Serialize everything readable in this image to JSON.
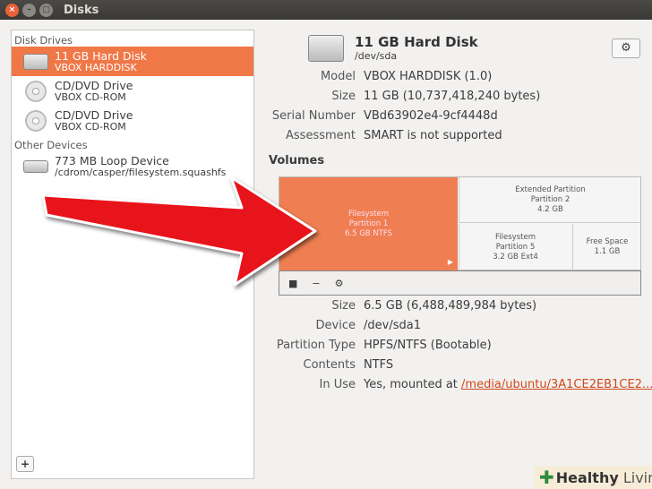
{
  "window": {
    "title": "Disks"
  },
  "sidebar": {
    "sections": [
      {
        "label": "Disk Drives",
        "items": [
          {
            "name": "11 GB Hard Disk",
            "sub": "VBOX HARDDISK",
            "icon": "hard-disk-icon"
          },
          {
            "name": "CD/DVD Drive",
            "sub": "VBOX CD-ROM",
            "icon": "cdrom-icon"
          },
          {
            "name": "CD/DVD Drive",
            "sub": "VBOX CD-ROM",
            "icon": "cdrom-icon"
          }
        ]
      },
      {
        "label": "Other Devices",
        "items": [
          {
            "name": "773 MB Loop Device",
            "sub": "/cdrom/casper/filesystem.squashfs",
            "icon": "loop-device-icon"
          }
        ]
      }
    ],
    "add_label": "+"
  },
  "disk": {
    "title": "11 GB Hard Disk",
    "device": "/dev/sda",
    "gear": "⚙",
    "props": [
      {
        "k": "Model",
        "v": "VBOX HARDDISK (1.0)"
      },
      {
        "k": "Size",
        "v": "11 GB (10,737,418,240 bytes)"
      },
      {
        "k": "Serial Number",
        "v": "VBd63902e4-9cf4448d"
      },
      {
        "k": "Assessment",
        "v": "SMART is not supported"
      }
    ]
  },
  "volumes": {
    "label": "Volumes",
    "partitions": [
      {
        "l1": "Filesystem",
        "l2": "Partition 1",
        "l3": "6.5 GB NTFS"
      },
      {
        "l1": "Extended Partition",
        "l2": "Partition 2",
        "l3": "4.2 GB"
      },
      {
        "l1": "Filesystem",
        "l2": "Partition 5",
        "l3": "3.2 GB Ext4"
      },
      {
        "l1": "Free Space",
        "l2": "1.1 GB"
      }
    ],
    "tools": {
      "stop": "■",
      "remove": "−",
      "settings": "⚙"
    }
  },
  "partition": {
    "props": [
      {
        "k": "Size",
        "v": "6.5 GB (6,488,489,984 bytes)"
      },
      {
        "k": "Device",
        "v": "/dev/sda1"
      },
      {
        "k": "Partition Type",
        "v": "HPFS/NTFS (Bootable)"
      },
      {
        "k": "Contents",
        "v": "NTFS"
      }
    ],
    "in_use": {
      "k": "In Use",
      "v": "Yes, mounted at ",
      "link": "/media/ubuntu/3A1CE2EB1CE2..."
    }
  },
  "watermark": {
    "bold": "Healthy",
    "rest": " Living"
  },
  "colors": {
    "accent": "#f07746",
    "arrow": "#e8141b"
  }
}
